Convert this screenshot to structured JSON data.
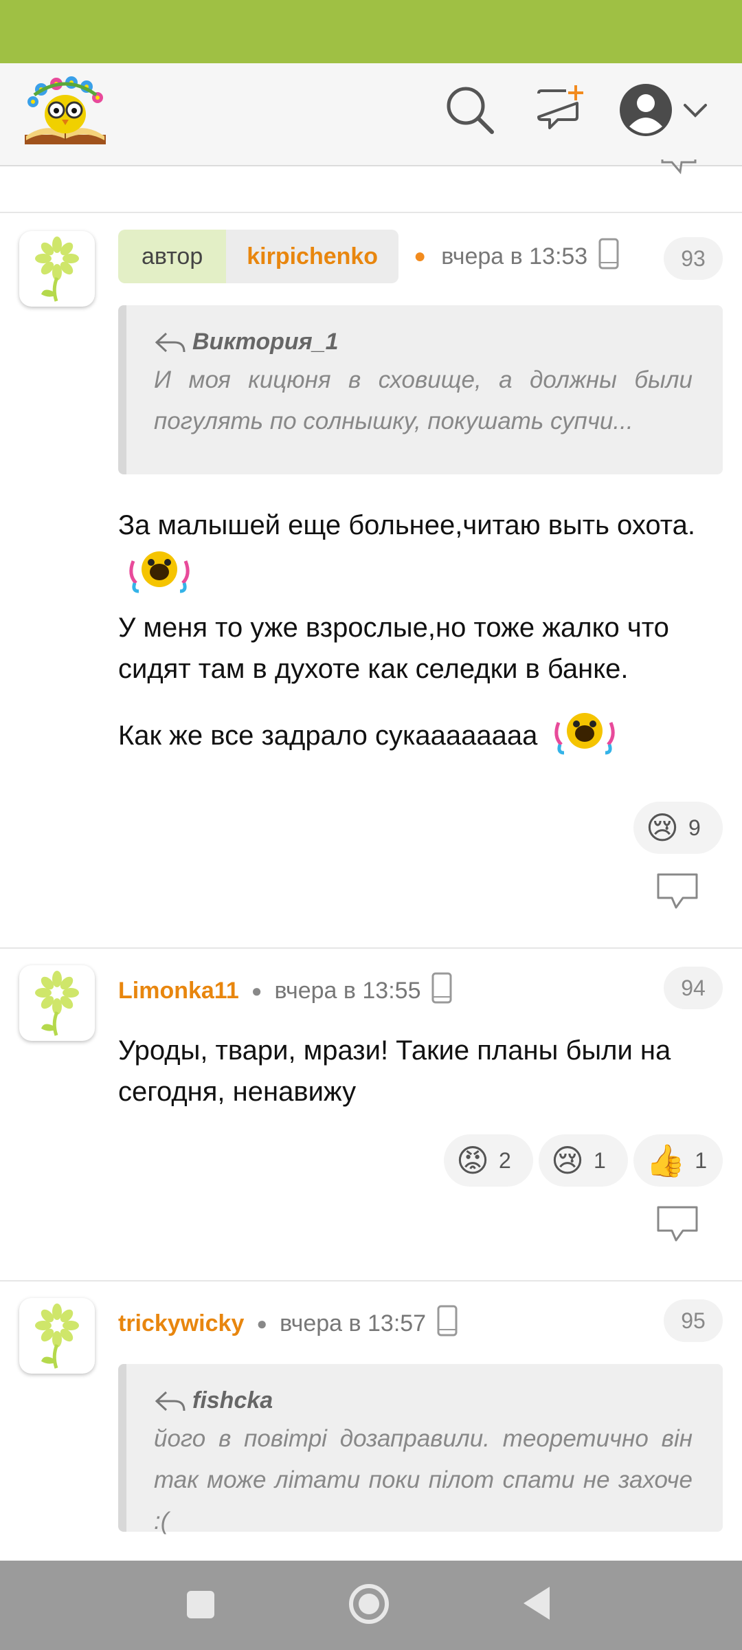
{
  "colors": {
    "status_bar": "#9fc044",
    "username": "#e8860e",
    "nav_bar": "#9b9b9b"
  },
  "header": {
    "logo_icon": "book-owl-logo-icon",
    "search_icon": "search-icon",
    "new_message_icon": "new-message-icon",
    "profile_icon": "profile-avatar-icon"
  },
  "comments": [
    {
      "author_tag": "автор",
      "username": "kirpichenko",
      "time": "вчера в 13:53",
      "number": "93",
      "quote": {
        "author": "Виктория_1",
        "text": "И моя кицюня в сховище, а должны были погулять по солнышку, покушать супчи..."
      },
      "paragraphs": [
        "За малышей еще больнее,читаю выть охота.",
        "У меня то уже взрослые,но тоже жалко что сидят там в духоте как селедки в банке.",
        "Как же все задрало сукаааааааа"
      ],
      "reactions": [
        {
          "emoji": "😢",
          "count": "9"
        }
      ]
    },
    {
      "username": "Limonka11",
      "time": "вчера в 13:55",
      "number": "94",
      "paragraphs": [
        "Уроды, твари, мрази! Такие планы были на сегодня, ненавижу"
      ],
      "reactions": [
        {
          "emoji": "😡",
          "count": "2"
        },
        {
          "emoji": "😢",
          "count": "1"
        },
        {
          "emoji": "👍",
          "count": "1"
        }
      ]
    },
    {
      "username": "trickywicky",
      "time": "вчера в 13:57",
      "number": "95",
      "quote": {
        "author": "fishcka",
        "text": "його в повітрі дозаправили. теоретично він так може літати поки пілот спати не захоче :("
      }
    }
  ]
}
